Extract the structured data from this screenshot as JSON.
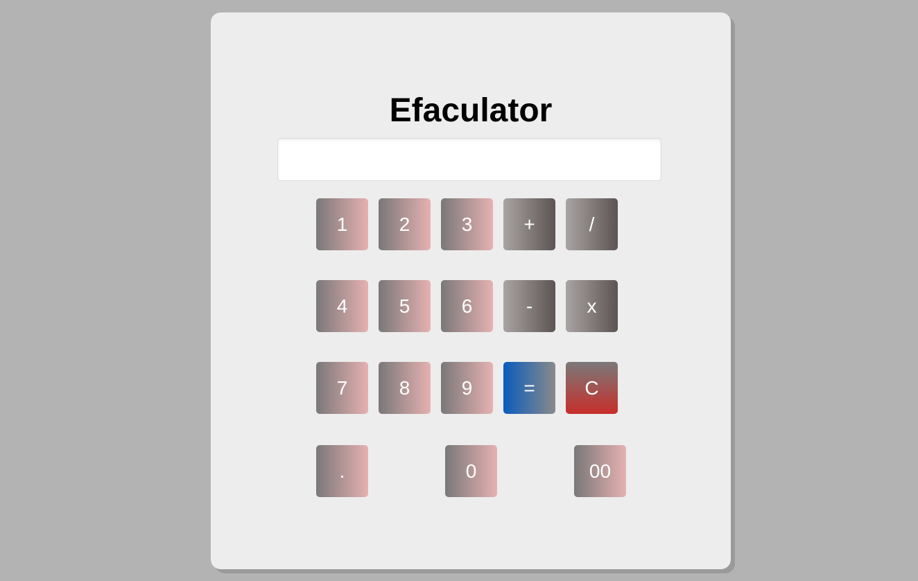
{
  "app": {
    "title": "Efaculator"
  },
  "display": {
    "value": ""
  },
  "keys": {
    "k1": "1",
    "k2": "2",
    "k3": "3",
    "plus": "+",
    "divide": "/",
    "k4": "4",
    "k5": "5",
    "k6": "6",
    "minus": "-",
    "multiply": "x",
    "k7": "7",
    "k8": "8",
    "k9": "9",
    "equals": "=",
    "clear": "C",
    "dot": ".",
    "k0": "0",
    "k00": "00"
  },
  "colors": {
    "page_background": "#b3b3b3",
    "card_background": "#ededed",
    "number_key_gradient": [
      "#7a7878",
      "#e6b1b1"
    ],
    "operator_key_gradient": [
      "#a9a4a3",
      "#5c5453"
    ],
    "equals_key_gradient": [
      "#0a5cbc",
      "#8a8a8a"
    ],
    "clear_key_gradient": [
      "#7a7a7a",
      "#c72e2b"
    ]
  }
}
